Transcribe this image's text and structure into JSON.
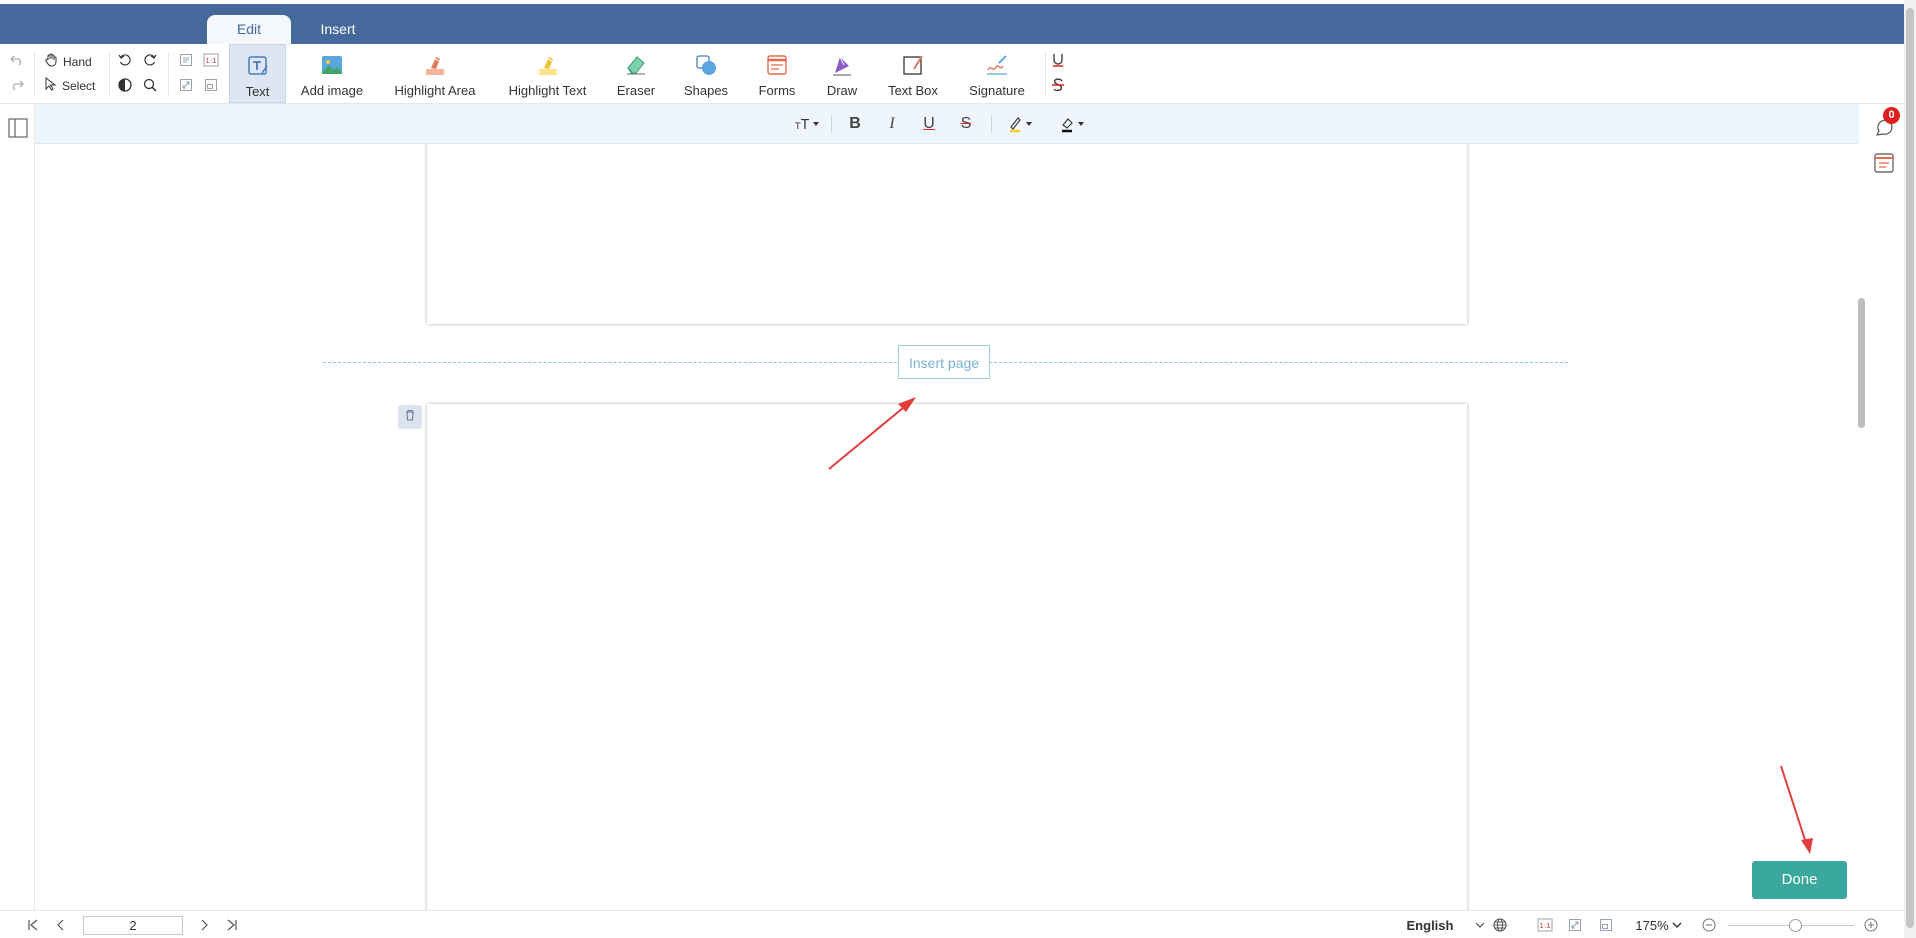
{
  "tabs": [
    {
      "label": "Edit",
      "active": true
    },
    {
      "label": "Insert",
      "active": false
    }
  ],
  "toolbar": {
    "hand_label": "Hand",
    "select_label": "Select",
    "tools": [
      {
        "label": "Text",
        "icon": "text-tool-icon",
        "selected": true
      },
      {
        "label": "Add image",
        "icon": "image-icon"
      },
      {
        "label": "Highlight Area",
        "icon": "highlight-area-icon"
      },
      {
        "label": "Highlight Text",
        "icon": "highlight-text-icon"
      },
      {
        "label": "Eraser",
        "icon": "eraser-icon"
      },
      {
        "label": "Shapes",
        "icon": "shapes-icon"
      },
      {
        "label": "Forms",
        "icon": "forms-icon"
      },
      {
        "label": "Draw",
        "icon": "draw-icon"
      },
      {
        "label": "Text Box",
        "icon": "text-box-icon"
      },
      {
        "label": "Signature",
        "icon": "signature-icon"
      }
    ],
    "small_fit_label": "1:1"
  },
  "format_bar": {
    "font_size_icon": "font-size-icon",
    "bold": "B",
    "italic": "I",
    "underline": "U",
    "strikethrough": "S"
  },
  "document": {
    "insert_page_label": "Insert page"
  },
  "done_label": "Done",
  "comments_badge": "0",
  "bottom": {
    "current_page": "2",
    "language": "English",
    "fit_label": "1:1",
    "zoom": "175%"
  },
  "colors": {
    "header": "#44699a",
    "accent": "#3aa89f",
    "highlight_yellow": "#f2d21b",
    "badge_red": "#e02020"
  }
}
